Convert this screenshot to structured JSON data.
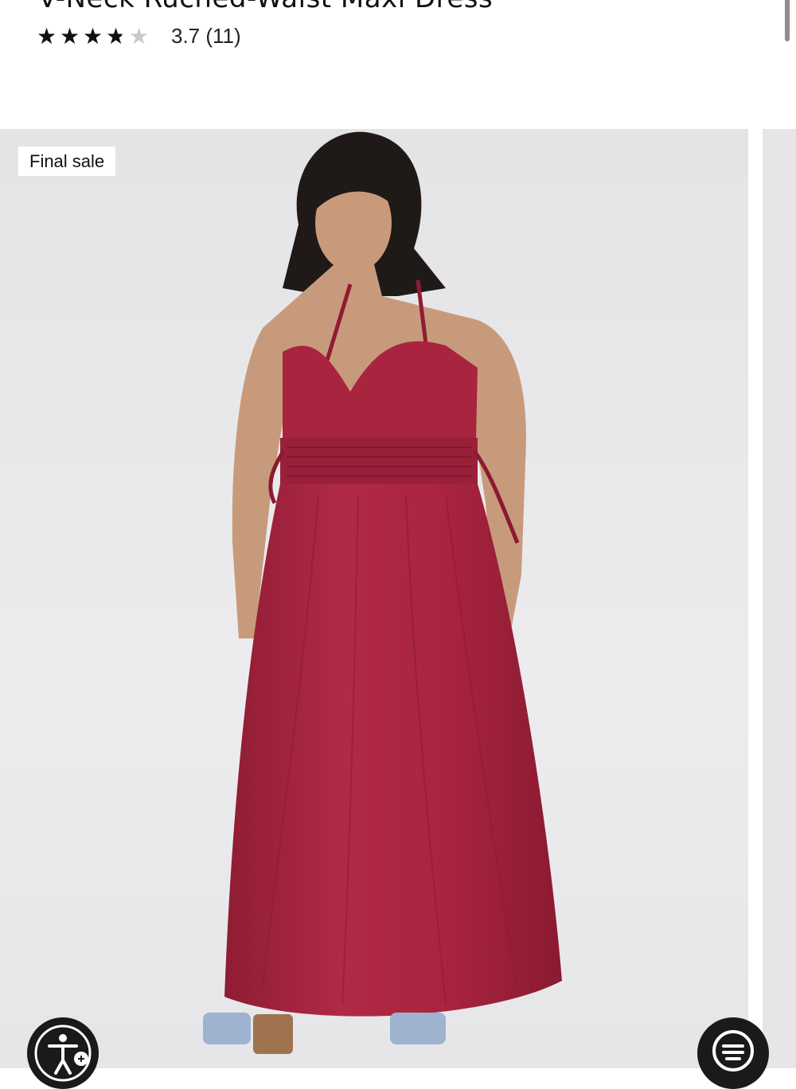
{
  "product": {
    "title": "V-Neck Ruched-Waist Maxi Dress",
    "rating_value": 3.7,
    "rating_text": "3.7 (11)"
  },
  "gallery": {
    "badge": "Final sale"
  },
  "icons": {
    "accessibility": "accessibility-icon",
    "chat": "chat-menu-icon"
  },
  "colors": {
    "dress": "#a8243f",
    "photo_background": "#e8e8ea",
    "star_filled": "#111111",
    "star_empty": "#c9c9c9"
  }
}
